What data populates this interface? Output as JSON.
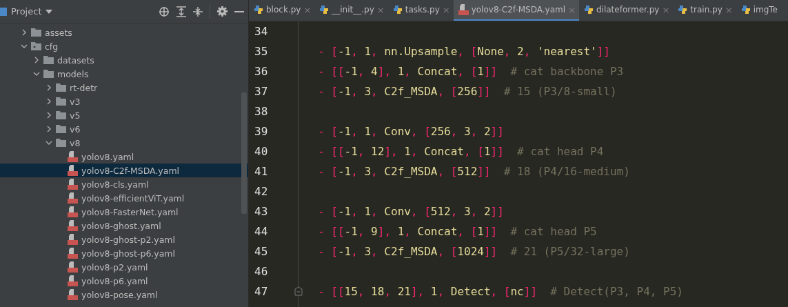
{
  "project_panel": {
    "title": "Project",
    "tree": [
      {
        "name": "assets",
        "kind": "folder",
        "expanded": false
      },
      {
        "name": "cfg",
        "kind": "package",
        "expanded": true,
        "children": [
          {
            "name": "datasets",
            "kind": "folder",
            "expanded": false
          },
          {
            "name": "models",
            "kind": "folder",
            "expanded": true,
            "children": [
              {
                "name": "rt-detr",
                "kind": "folder",
                "expanded": false
              },
              {
                "name": "v3",
                "kind": "folder",
                "expanded": false
              },
              {
                "name": "v5",
                "kind": "folder",
                "expanded": false
              },
              {
                "name": "v6",
                "kind": "folder",
                "expanded": false
              },
              {
                "name": "v8",
                "kind": "folder",
                "expanded": true,
                "children": [
                  {
                    "name": "yolov8.yaml",
                    "kind": "yaml",
                    "selected": false
                  },
                  {
                    "name": "yolov8-C2f-MSDA.yaml",
                    "kind": "yaml",
                    "selected": true
                  },
                  {
                    "name": "yolov8-cls.yaml",
                    "kind": "yaml",
                    "selected": false
                  },
                  {
                    "name": "yolov8-efficientViT.yaml",
                    "kind": "yaml",
                    "selected": false
                  },
                  {
                    "name": "yolov8-FasterNet.yaml",
                    "kind": "yaml",
                    "selected": false
                  },
                  {
                    "name": "yolov8-ghost.yaml",
                    "kind": "yaml",
                    "selected": false
                  },
                  {
                    "name": "yolov8-ghost-p2.yaml",
                    "kind": "yaml",
                    "selected": false
                  },
                  {
                    "name": "yolov8-ghost-p6.yaml",
                    "kind": "yaml",
                    "selected": false
                  },
                  {
                    "name": "yolov8-p2.yaml",
                    "kind": "yaml",
                    "selected": false
                  },
                  {
                    "name": "yolov8-p6.yaml",
                    "kind": "yaml",
                    "selected": false
                  },
                  {
                    "name": "yolov8-pose.yaml",
                    "kind": "yaml",
                    "selected": false
                  }
                ]
              }
            ]
          }
        ]
      }
    ]
  },
  "tabs": [
    {
      "label": "block.py",
      "kind": "python",
      "selected": false,
      "close": "×"
    },
    {
      "label": "__init__.py",
      "kind": "python",
      "selected": false,
      "close": "×"
    },
    {
      "label": "tasks.py",
      "kind": "python",
      "selected": false,
      "close": "×"
    },
    {
      "label": "yolov8-C2f-MSDA.yaml",
      "kind": "yaml",
      "selected": true,
      "close": "×"
    },
    {
      "label": "dilateformer.py",
      "kind": "python",
      "selected": false,
      "close": "×"
    },
    {
      "label": "train.py",
      "kind": "python",
      "selected": false,
      "close": "×"
    },
    {
      "label": "imgTe",
      "kind": "python",
      "selected": false
    }
  ],
  "editor": {
    "lines": [
      {
        "number": "34"
      },
      {
        "number": "35",
        "code": "- [-1, 1, nn.Upsample, [None, 2, 'nearest']]"
      },
      {
        "number": "36",
        "code": "- [[-1, 4], 1, Concat, [1]]",
        "comment": "# cat backbone P3"
      },
      {
        "number": "37",
        "code": "- [-1, 3, C2f_MSDA, [256]]",
        "comment": "# 15 (P3/8-small)"
      },
      {
        "number": "38"
      },
      {
        "number": "39",
        "code": "- [-1, 1, Conv, [256, 3, 2]]"
      },
      {
        "number": "40",
        "code": "- [[-1, 12], 1, Concat, [1]]",
        "comment": "# cat head P4"
      },
      {
        "number": "41",
        "code": "- [-1, 3, C2f_MSDA, [512]]",
        "comment": "# 18 (P4/16-medium)"
      },
      {
        "number": "42"
      },
      {
        "number": "43",
        "code": "- [-1, 1, Conv, [512, 3, 2]]"
      },
      {
        "number": "44",
        "code": "- [[-1, 9], 1, Concat, [1]]",
        "comment": "# cat head P5"
      },
      {
        "number": "45",
        "code": "- [-1, 3, C2f_MSDA, [1024]]",
        "comment": "# 21 (P5/32-large)"
      },
      {
        "number": "46"
      },
      {
        "number": "47",
        "code": "- [[15, 18, 21], 1, Detect, [nc]]",
        "comment": "# Detect(P3, P4, P5)",
        "foldable": true
      }
    ]
  }
}
